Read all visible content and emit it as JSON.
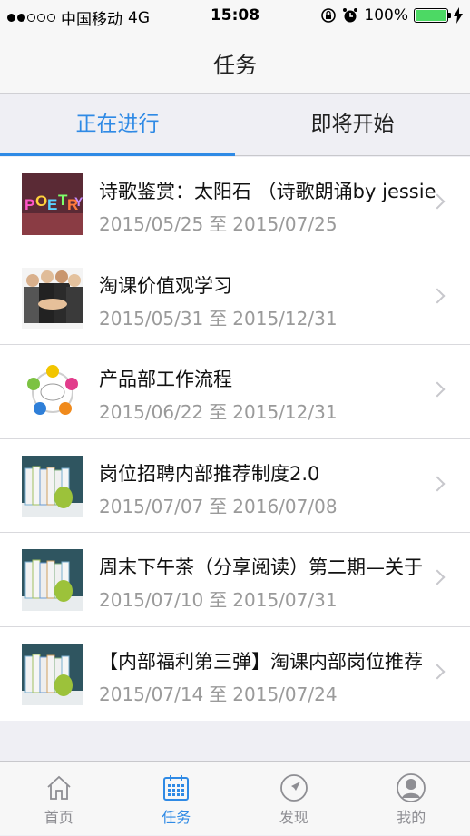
{
  "status_bar": {
    "carrier": "中国移动",
    "network": "4G",
    "time": "15:08",
    "battery": "100%"
  },
  "nav": {
    "title": "任务"
  },
  "tabs": [
    {
      "label": "正在进行",
      "active": true
    },
    {
      "label": "即将开始",
      "active": false
    }
  ],
  "tasks": [
    {
      "title": "诗歌鉴赏：太阳石 （诗歌朗诵by jessie",
      "start": "2015/05/25",
      "to": "至",
      "end": "2015/07/25",
      "thumb": "poetry"
    },
    {
      "title": "淘课价值观学习",
      "start": "2015/05/31",
      "to": "至",
      "end": "2015/12/31",
      "thumb": "team-hands"
    },
    {
      "title": "产品部工作流程",
      "start": "2015/06/22",
      "to": "至",
      "end": "2015/12/31",
      "thumb": "work-process"
    },
    {
      "title": "岗位招聘内部推荐制度2.0",
      "start": "2015/07/07",
      "to": "至",
      "end": "2016/07/08",
      "thumb": "books-apple"
    },
    {
      "title": "周末下午茶（分享阅读）第二期—关于",
      "start": "2015/07/10",
      "to": "至",
      "end": "2015/07/31",
      "thumb": "books-apple"
    },
    {
      "title": "【内部福利第三弹】淘课内部岗位推荐",
      "start": "2015/07/14",
      "to": "至",
      "end": "2015/07/24",
      "thumb": "books-apple"
    }
  ],
  "bottom_tabs": [
    {
      "label": "首页",
      "icon": "home-icon",
      "active": false
    },
    {
      "label": "任务",
      "icon": "calendar-icon",
      "active": true
    },
    {
      "label": "发现",
      "icon": "compass-icon",
      "active": false
    },
    {
      "label": "我的",
      "icon": "user-icon",
      "active": false
    }
  ],
  "colors": {
    "accent": "#2f8ae5",
    "battery": "#4cd964"
  }
}
